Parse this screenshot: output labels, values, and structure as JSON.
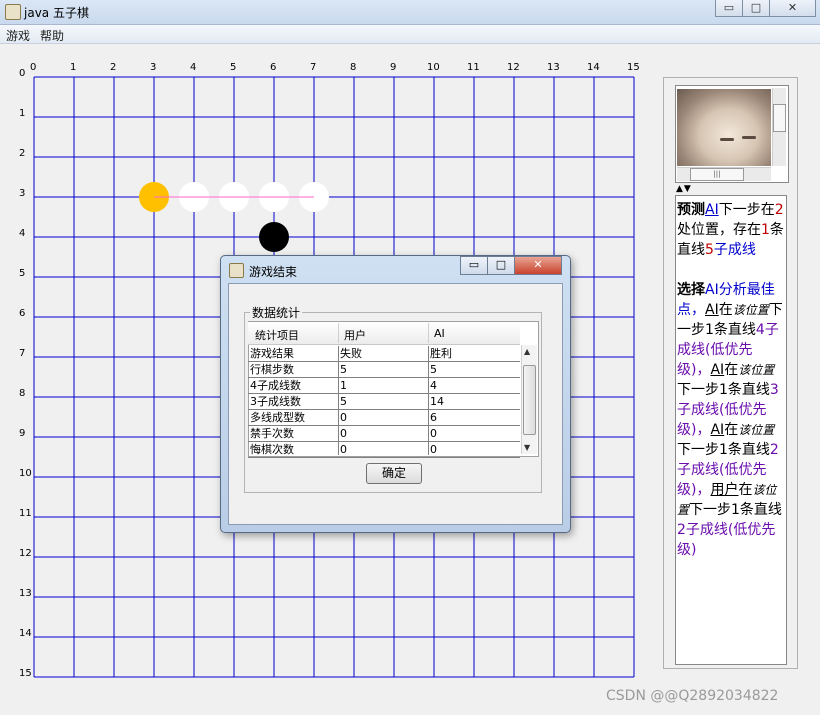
{
  "window": {
    "title": "java 五子棋",
    "buttons": {
      "minimize": "▭",
      "maximize": "□",
      "close": "✕"
    }
  },
  "menu": [
    "游戏",
    "帮助"
  ],
  "board": {
    "size": 15,
    "line_color": "#0000cc",
    "top_labels": [
      "0",
      "1",
      "2",
      "3",
      "4",
      "5",
      "6",
      "7",
      "8",
      "9",
      "10",
      "11",
      "12",
      "13",
      "14",
      "15"
    ],
    "left_labels": [
      "0",
      "1",
      "2",
      "3",
      "4",
      "5",
      "6",
      "7",
      "8",
      "9",
      "10",
      "11",
      "12",
      "13",
      "14",
      "15"
    ],
    "stones": [
      {
        "col": 3,
        "row": 3,
        "color": "#ffc000"
      },
      {
        "col": 4,
        "row": 3,
        "color": "#ffffff"
      },
      {
        "col": 5,
        "row": 3,
        "color": "#ffffff"
      },
      {
        "col": 6,
        "row": 3,
        "color": "#ffffff"
      },
      {
        "col": 7,
        "row": 3,
        "color": "#ffffff"
      },
      {
        "col": 6,
        "row": 4,
        "color": "#000000"
      }
    ],
    "win_line": {
      "from": [
        3,
        3
      ],
      "to": [
        7,
        3
      ],
      "color": "#ff66cc"
    }
  },
  "side_panel": {
    "image": "sleeping-cat-image",
    "split_arrows": "▲▼",
    "info": {
      "prediction": {
        "lead": "预测",
        "ai": "AI",
        "text1": "下一步在",
        "num1": "2",
        "text2": "处位置，存在",
        "num2": "1",
        "text3": "条直线",
        "num3": "5",
        "text4": "子成线"
      },
      "selection": {
        "lead": "选择",
        "rest": "AI分析最佳点，",
        "items": [
          {
            "who": "AI",
            "pre": "在",
            "loc": "该位置",
            "mid": "下一步1条直线",
            "num": "4",
            "tail": "子成线(低优先级)，"
          },
          {
            "who": "AI",
            "pre": "在",
            "loc": "该位置",
            "mid": "下一步1条直线",
            "num": "3",
            "tail": "子成线(低优先级)，"
          },
          {
            "who": "AI",
            "pre": "在",
            "loc": "该位置",
            "mid": "下一步1条直线",
            "num": "2",
            "tail": "子成线(低优先级)，"
          },
          {
            "who": "用户",
            "pre": "在",
            "loc": "该位置",
            "mid": "下一步1条直线",
            "num": "2",
            "tail": "子成线(低优先级)"
          }
        ]
      }
    }
  },
  "dialog": {
    "title": "游戏结束",
    "group_title": "数据统计",
    "columns": [
      "统计项目",
      "用户",
      "AI"
    ],
    "rows": [
      [
        "游戏结果",
        "失败",
        "胜利"
      ],
      [
        "行棋步数",
        "5",
        "5"
      ],
      [
        "4子成线数",
        "1",
        "4"
      ],
      [
        "3子成线数",
        "5",
        "14"
      ],
      [
        "多线成型数",
        "0",
        "6"
      ],
      [
        "禁手次数",
        "0",
        "0"
      ],
      [
        "悔棋次数",
        "0",
        "0"
      ]
    ],
    "ok_label": "确定"
  },
  "watermark": "CSDN @@Q2892034822"
}
